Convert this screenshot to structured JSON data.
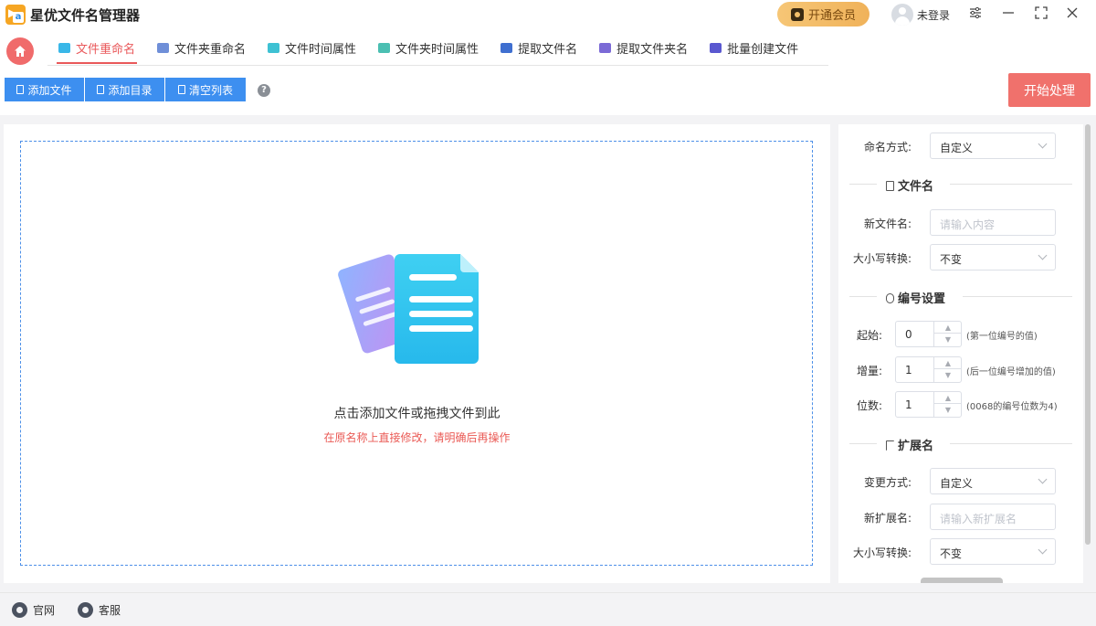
{
  "app": {
    "title": "星优文件名管理器",
    "vip_label": "开通会员",
    "login_label": "未登录"
  },
  "tabs": [
    {
      "label": "文件重命名",
      "active": true,
      "icon": "rename-file-icon",
      "color": "#39b7e8"
    },
    {
      "label": "文件夹重命名",
      "active": false,
      "icon": "rename-folder-icon",
      "color": "#6f8fd8"
    },
    {
      "label": "文件时间属性",
      "active": false,
      "icon": "file-time-icon",
      "color": "#3ec1d3"
    },
    {
      "label": "文件夹时间属性",
      "active": false,
      "icon": "folder-time-icon",
      "color": "#4bbfb2"
    },
    {
      "label": "提取文件名",
      "active": false,
      "icon": "extract-filename-icon",
      "color": "#3f6fd0"
    },
    {
      "label": "提取文件夹名",
      "active": false,
      "icon": "extract-foldername-icon",
      "color": "#7b6ad6"
    },
    {
      "label": "批量创建文件",
      "active": false,
      "icon": "batch-create-icon",
      "color": "#5a58d0"
    }
  ],
  "toolbar": {
    "add_file": "添加文件",
    "add_dir": "添加目录",
    "clear_list": "清空列表",
    "start": "开始处理"
  },
  "dropzone": {
    "main_text": "点击添加文件或拖拽文件到此",
    "warn_text": "在原名称上直接修改，请明确后再操作"
  },
  "settings": {
    "naming_mode_label": "命名方式:",
    "naming_mode_value": "自定义",
    "filename_section": "文件名",
    "new_filename_label": "新文件名:",
    "new_filename_placeholder": "请输入内容",
    "case_label": "大小写转换:",
    "case_value": "不变",
    "numbering_section": "编号设置",
    "start_label": "起始:",
    "start_value": "0",
    "start_hint": "(第一位编号的值)",
    "increment_label": "增量:",
    "increment_value": "1",
    "increment_hint": "(后一位编号增加的值)",
    "digits_label": "位数:",
    "digits_value": "1",
    "digits_hint": "(0068的编号位数为4)",
    "ext_section": "扩展名",
    "change_mode_label": "变更方式:",
    "change_mode_value": "自定义",
    "new_ext_label": "新扩展名:",
    "new_ext_placeholder": "请输入新扩展名",
    "ext_case_label": "大小写转换:",
    "ext_case_value": "不变"
  },
  "footer": {
    "website": "官网",
    "support": "客服"
  },
  "colors": {
    "accent_red": "#e9585a",
    "start_button": "#f0716c",
    "toolbar_blue": "#3d8ff0",
    "vip_gold": "#f2b964"
  }
}
